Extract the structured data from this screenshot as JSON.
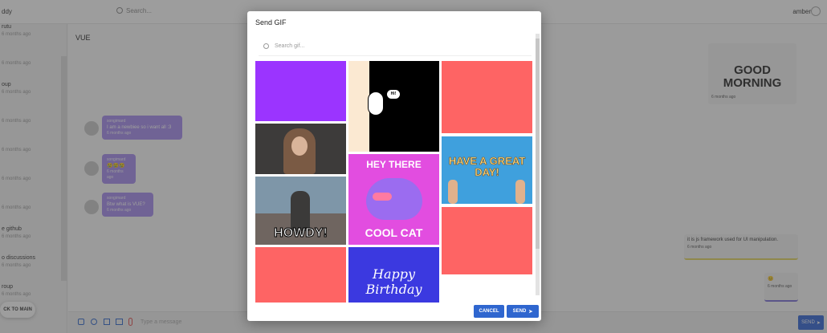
{
  "header": {
    "app_title": "ddy",
    "search_placeholder": "Search...",
    "username": "amber"
  },
  "sidebar": {
    "items": [
      {
        "label": "rutu",
        "time": "6 months ago"
      },
      {
        "label": "",
        "time": "6 months ago"
      },
      {
        "label": "oup",
        "time": "6 months ago"
      },
      {
        "label": "",
        "time": "6 months ago"
      },
      {
        "label": "",
        "time": "6 months ago"
      },
      {
        "label": "",
        "time": "6 months ago"
      },
      {
        "label": "",
        "time": "6 months ago"
      },
      {
        "label": "e github",
        "time": "6 months ago"
      },
      {
        "label": "o discussions",
        "time": "6 months ago"
      },
      {
        "label": "roup",
        "time": "6 months ago"
      }
    ],
    "back_button": "CK TO MAIN"
  },
  "chat": {
    "title": "VUE",
    "messages": [
      {
        "name": "songimard",
        "text": "I am a newbiee so i want all :3",
        "time": "6 months ago"
      },
      {
        "name": "songimard",
        "text": "😢😢😢",
        "time": "6 months ago"
      },
      {
        "name": "songimard",
        "text": "Btw what is VUE?",
        "time": "6 months ago"
      }
    ],
    "right_messages": [
      {
        "text": "GOOD MORNING",
        "time": "6 months ago"
      },
      {
        "text": "it is js framework used for UI manipulation.",
        "time": "6 months ago"
      },
      {
        "text": "😐",
        "time": "6 months ago"
      }
    ],
    "input_placeholder": "Type a message",
    "send_label": "SEND"
  },
  "modal": {
    "title": "Send GIF",
    "search_placeholder": "Search gif...",
    "gifs": [
      {
        "caption": ""
      },
      {
        "caption": "Hi!"
      },
      {
        "caption": ""
      },
      {
        "caption": ""
      },
      {
        "caption": "HEY THERE"
      },
      {
        "caption": "HAVE A GREAT DAY!"
      },
      {
        "caption": "HOWDY!"
      },
      {
        "caption": "COOL CAT"
      },
      {
        "caption": ""
      },
      {
        "caption": ""
      },
      {
        "caption": "Happy Birthday"
      }
    ],
    "cancel_label": "CANCEL",
    "send_label": "SEND"
  },
  "colors": {
    "accent": "#2f66cf",
    "bubble": "#a58bef",
    "placeholder_red": "#fe6464",
    "placeholder_purple": "#9b34ff"
  }
}
